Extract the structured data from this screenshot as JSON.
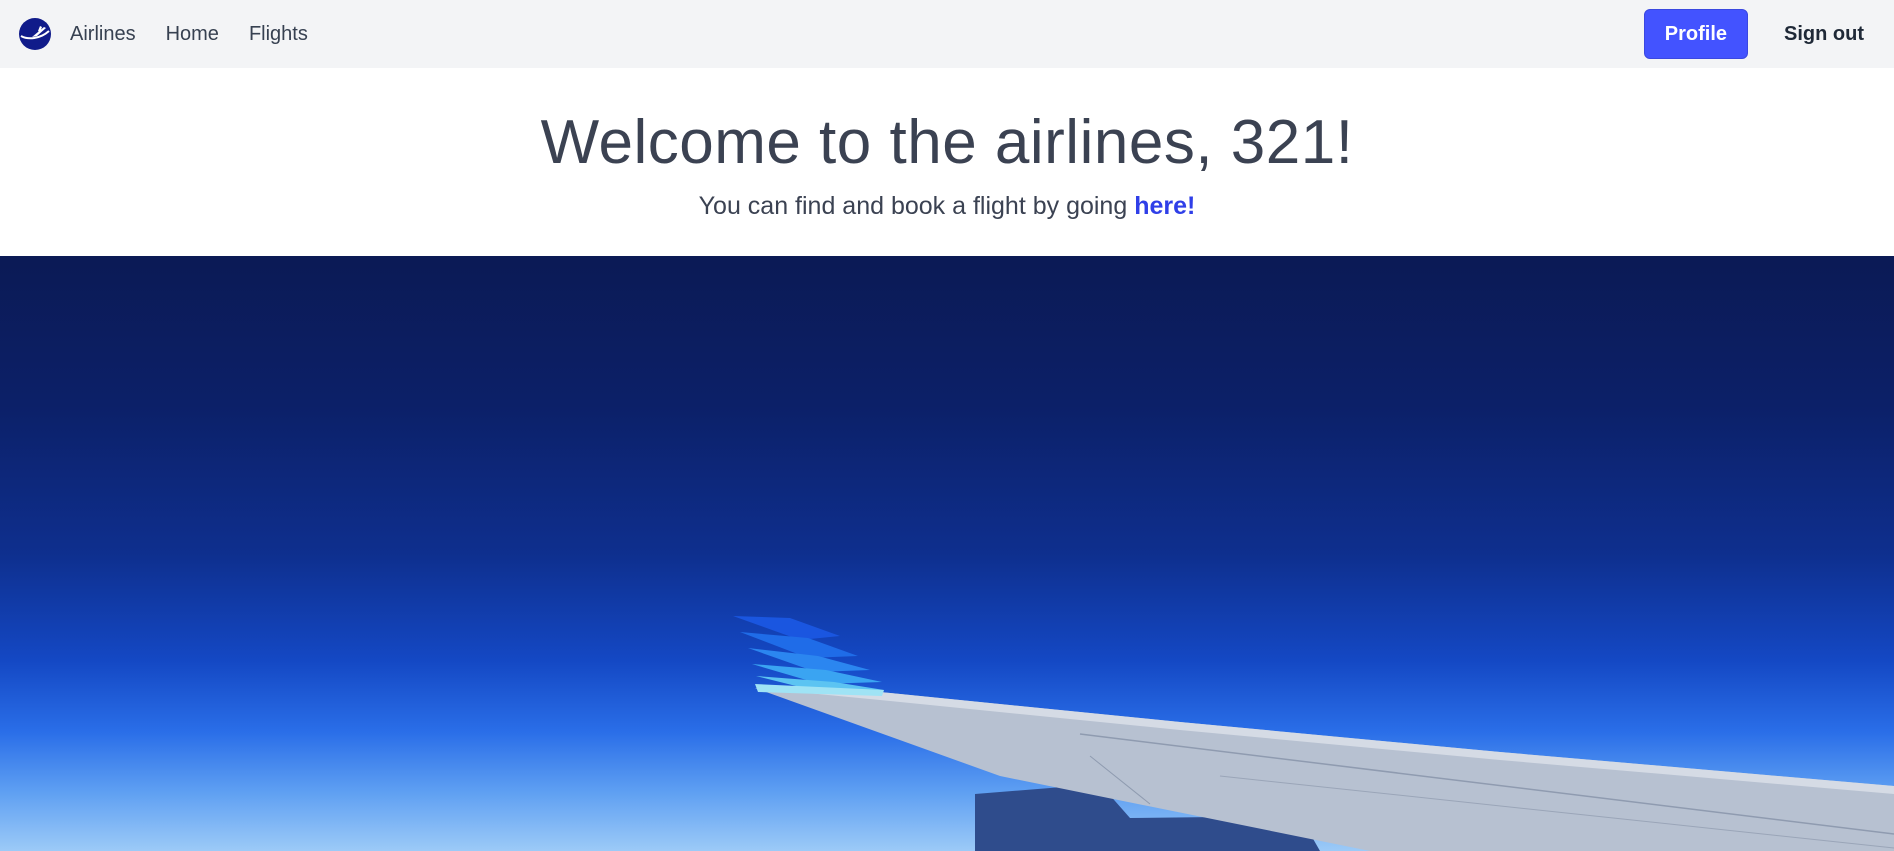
{
  "nav": {
    "brand": "Airlines",
    "links": [
      "Home",
      "Flights"
    ],
    "profile_label": "Profile",
    "signout_label": "Sign out"
  },
  "welcome": {
    "title": "Welcome to the airlines, 321!",
    "subtitle": "You can find and book a flight by going",
    "link_text": "here!"
  },
  "banner": {
    "sky_top_color": "#0b1a55",
    "sky_bottom_color": "#9ccaf7",
    "wing_color": "#b9c3d3",
    "winglet_colors": [
      "#1a56e0",
      "#2b86f0",
      "#5cc4f2"
    ]
  },
  "colors": {
    "accent": "#4353ff",
    "link": "#2f3fe8",
    "navbar_bg": "#f3f4f6",
    "text": "#3b4252"
  }
}
